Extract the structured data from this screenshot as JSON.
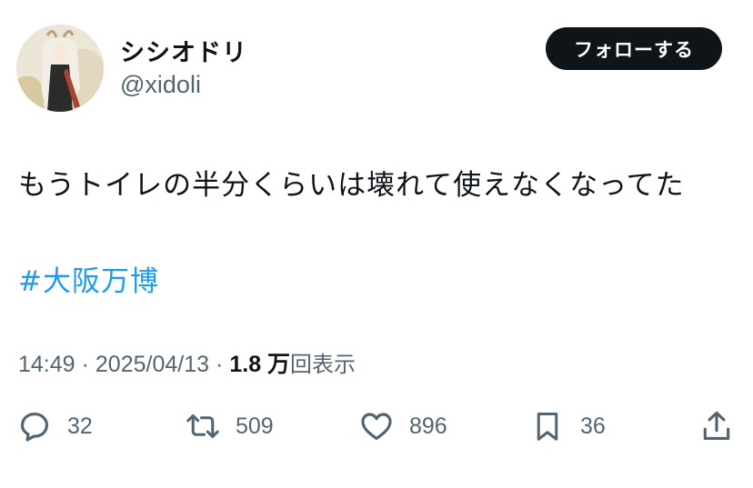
{
  "author": {
    "display_name": "シシオドリ",
    "handle": "@xidoli"
  },
  "follow_button": {
    "label": "フォローする"
  },
  "post": {
    "text": "もうトイレの半分くらいは壊れて使えなくなってた",
    "hashtag": "#大阪万博"
  },
  "meta": {
    "time": "14:49",
    "date": "2025/04/13",
    "separator": "·",
    "views_count": "1.8 万",
    "views_label": "回表示"
  },
  "actions": {
    "replies": "32",
    "reposts": "509",
    "likes": "896",
    "bookmarks": "36"
  },
  "icons": {
    "reply": "reply-icon",
    "repost": "repost-icon",
    "like": "heart-icon",
    "bookmark": "bookmark-icon",
    "share": "share-icon"
  },
  "colors": {
    "hashtag": "#1d9bf0",
    "follow_bg": "#0f1419",
    "secondary_text": "#536471"
  }
}
